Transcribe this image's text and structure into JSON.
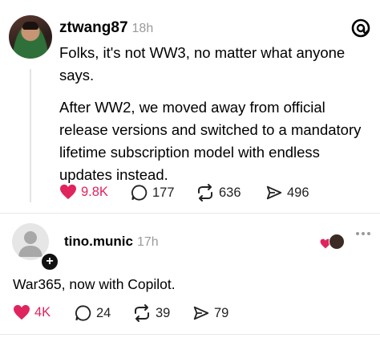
{
  "post": {
    "username": "ztwang87",
    "time": "18h",
    "para1_line1": "Folks, it's not WW3, no matter what anyone",
    "para1_line2": "says.",
    "para2_line1": "After WW2, we moved away from official",
    "para2_line2": "release versions and switched to a mandatory",
    "para2_line3": "lifetime subscription model with endless",
    "para2_line4": "updates instead.",
    "likes": "9.8K",
    "replies": "177",
    "reposts": "636",
    "shares": "496",
    "logo_icon": "threads-logo-icon"
  },
  "reply": {
    "username": "tino.munic",
    "time": "17h",
    "text": "War365, now with Copilot.",
    "likes": "4K",
    "replies": "24",
    "reposts": "39",
    "shares": "79"
  },
  "colors": {
    "like_red": "#e0245e",
    "muted": "#9a9a9a"
  }
}
